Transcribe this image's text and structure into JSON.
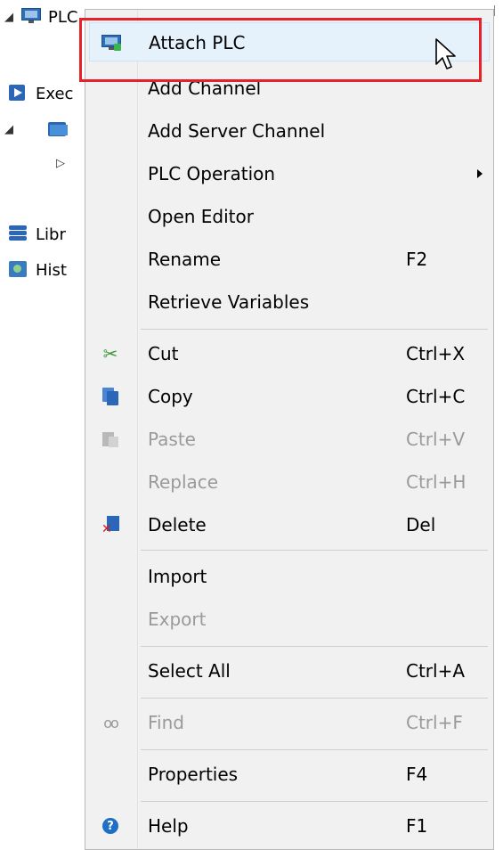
{
  "tree": {
    "items": [
      {
        "arrow": "◢",
        "icon": "monitor-icon",
        "label": "PLC"
      },
      {
        "arrow": "",
        "icon": "execution-icon",
        "label": "Exec"
      },
      {
        "arrow": "◢",
        "icon": "folder-icon",
        "label": ""
      },
      {
        "arrow": "▷",
        "icon": "",
        "label": ""
      },
      {
        "arrow": "",
        "icon": "library-icon",
        "label": "Libr"
      },
      {
        "arrow": "",
        "icon": "history-icon",
        "label": "Hist"
      }
    ]
  },
  "menu": {
    "attach_plc": {
      "label": "Attach PLC",
      "icon": "attach-plc-icon"
    },
    "add_channel": {
      "label": "Add Channel"
    },
    "add_server_channel": {
      "label": "Add Server Channel"
    },
    "plc_operation": {
      "label": "PLC Operation"
    },
    "open_editor": {
      "label": "Open Editor"
    },
    "rename": {
      "label": "Rename",
      "shortcut": "F2"
    },
    "retrieve_variables": {
      "label": "Retrieve Variables"
    },
    "cut": {
      "label": "Cut",
      "shortcut": "Ctrl+X",
      "icon": "scissors-icon"
    },
    "copy": {
      "label": "Copy",
      "shortcut": "Ctrl+C",
      "icon": "copy-icon"
    },
    "paste": {
      "label": "Paste",
      "shortcut": "Ctrl+V",
      "icon": "paste-icon",
      "disabled": true
    },
    "replace": {
      "label": "Replace",
      "shortcut": "Ctrl+H",
      "disabled": true
    },
    "delete": {
      "label": "Delete",
      "shortcut": "Del",
      "icon": "delete-icon"
    },
    "import": {
      "label": "Import"
    },
    "export": {
      "label": "Export",
      "disabled": true
    },
    "select_all": {
      "label": "Select All",
      "shortcut": "Ctrl+A"
    },
    "find": {
      "label": "Find",
      "shortcut": "Ctrl+F",
      "icon": "binoculars-icon",
      "disabled": true
    },
    "properties": {
      "label": "Properties",
      "shortcut": "F4"
    },
    "help": {
      "label": "Help",
      "shortcut": "F1",
      "icon": "help-icon"
    }
  },
  "colors": {
    "highlight_border": "#e8202a",
    "hover_background": "#e5f1fb",
    "menu_background": "#f1f1f1",
    "disabled_text": "#9a9a9a"
  }
}
